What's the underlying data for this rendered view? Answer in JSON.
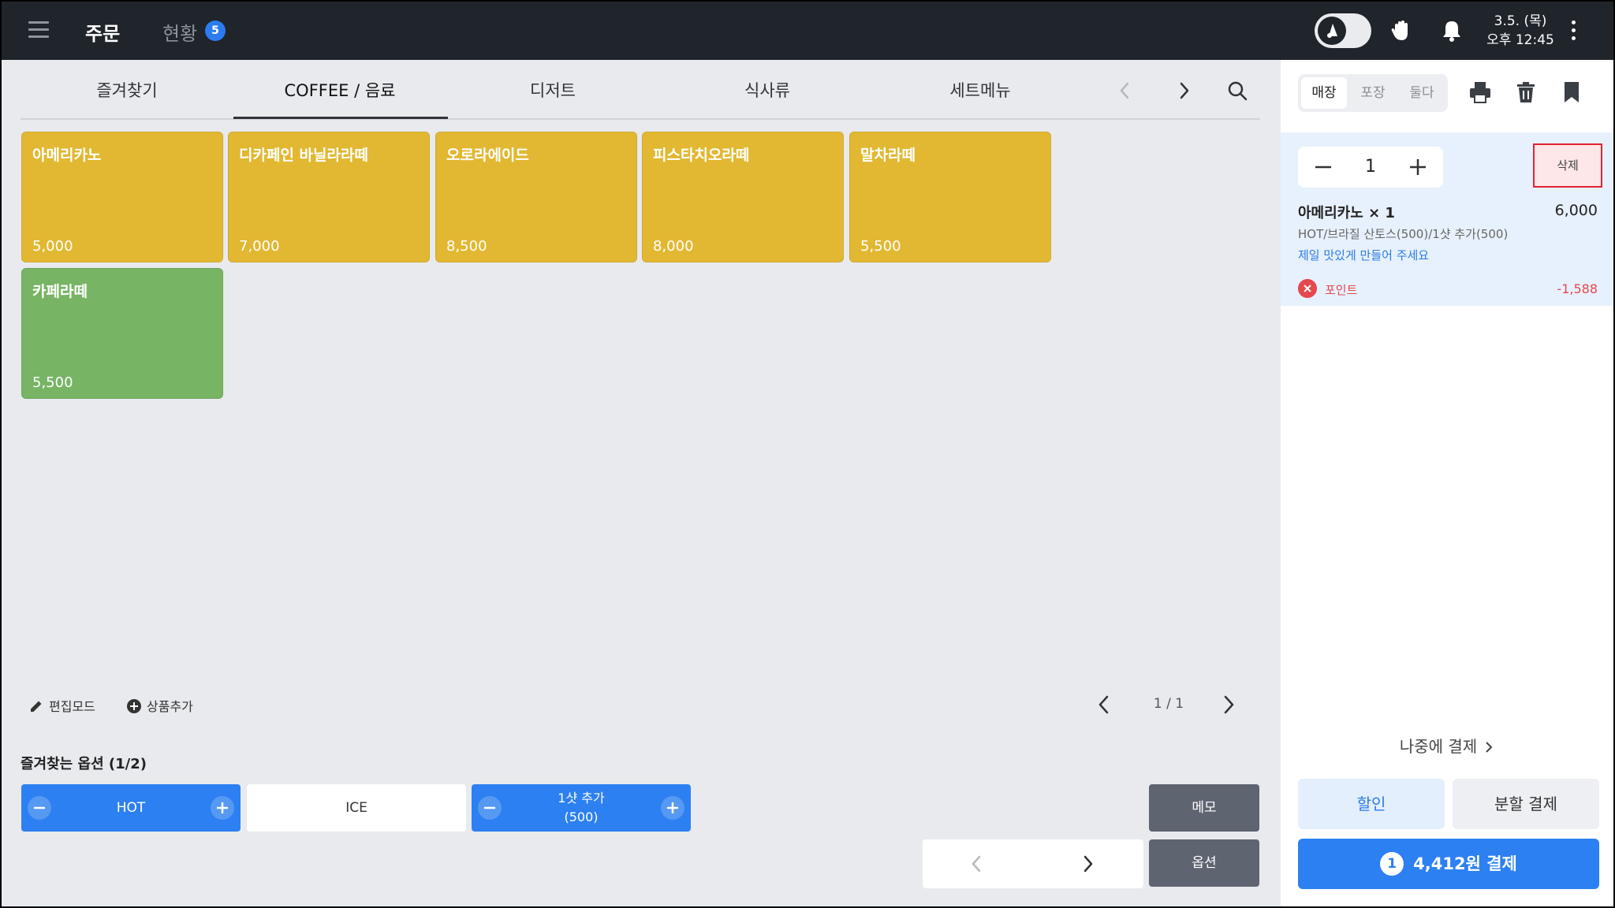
{
  "topbar": {
    "tab_order": "주문",
    "tab_status": "현황",
    "status_count": "5",
    "date": "3.5. (목)",
    "time": "오후 12:45"
  },
  "categories": [
    "즐겨찾기",
    "COFFEE / 음료",
    "디저트",
    "식사류",
    "세트메뉴"
  ],
  "active_category": "COFFEE / 음료",
  "products": [
    {
      "name": "아메리카노",
      "price": "5,000",
      "color": "#e2b832"
    },
    {
      "name": "디카페인 바닐라라떼",
      "price": "7,000",
      "color": "#e2b832"
    },
    {
      "name": "오로라에이드",
      "price": "8,500",
      "color": "#e2b832"
    },
    {
      "name": "피스타치오라떼",
      "price": "8,000",
      "color": "#e2b832"
    },
    {
      "name": "말차라떼",
      "price": "5,500",
      "color": "#e2b832"
    },
    {
      "name": "카페라떼",
      "price": "5,500",
      "color": "#77b464"
    }
  ],
  "tools": {
    "edit_mode": "편집모드",
    "add_product": "상품추가"
  },
  "pager": {
    "label": "1 / 1"
  },
  "fav_options": {
    "title": "즐겨찾는 옵션 (1/2)",
    "items": [
      {
        "label": "HOT",
        "selected": true
      },
      {
        "label": "ICE",
        "selected": false
      },
      {
        "label": "1샷 추가\n(500)",
        "selected": true
      }
    ]
  },
  "side_buttons": {
    "memo": "메모",
    "option": "옵션"
  },
  "order_panel": {
    "service_types": [
      "매장",
      "포장",
      "둘다"
    ],
    "active_service": "매장",
    "quantity": "1",
    "delete_label": "삭제",
    "item": {
      "name": "아메리카노 × 1",
      "price": "6,000",
      "options": "HOT/브라질 산토스(500)/1샷 추가(500)",
      "memo": "제일 맛있게 만들어 주세요"
    },
    "point": {
      "label": "포인트",
      "value": "-1,588"
    },
    "pay_later": "나중에 결제",
    "discount": "할인",
    "split_pay": "분할 결제",
    "pay_count": "1",
    "pay_label": "4,412원 결제"
  },
  "colors": {
    "accent": "#2c80f1",
    "danger": "#e5484d",
    "topbar": "#20242b"
  }
}
